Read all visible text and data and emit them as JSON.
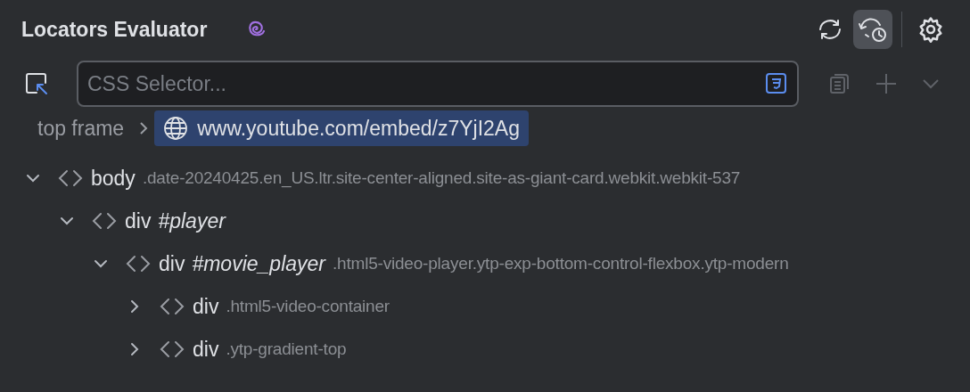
{
  "panel": {
    "title": "Locators Evaluator"
  },
  "toolbar": [
    {
      "kind": "refresh",
      "selected": false
    },
    {
      "kind": "history",
      "selected": true
    },
    {
      "kind": "settings",
      "selected": false
    }
  ],
  "selector": {
    "placeholder": "CSS Selector..."
  },
  "breadcrumb": [
    {
      "label": "top frame",
      "selected": false,
      "kind": "frame"
    },
    {
      "label": "www.youtube.com/embed/z7YjI2Ag",
      "selected": true,
      "kind": "globe"
    }
  ],
  "tree": [
    {
      "tag": "body",
      "classes": ".date-20240425.en_US.ltr.site-center-aligned.site-as-giant-card.webkit.webkit-537",
      "expanded": true,
      "children": [
        {
          "tag": "div",
          "id": "#player",
          "expanded": true,
          "children": [
            {
              "tag": "div",
              "id": "#movie_player",
              "classes": ".html5-video-player.ytp-exp-bottom-control-flexbox.ytp-modern",
              "expanded": true,
              "children": [
                {
                  "tag": "div",
                  "classes": ".html5-video-container",
                  "expanded": false
                },
                {
                  "tag": "div",
                  "classes": ".ytp-gradient-top",
                  "expanded": false
                }
              ]
            }
          ]
        }
      ]
    }
  ]
}
